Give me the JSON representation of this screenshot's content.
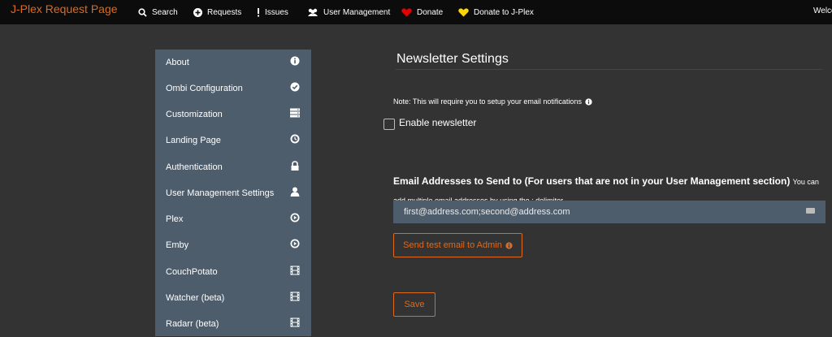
{
  "navbar": {
    "brand": "J-Plex Request Page",
    "items": [
      {
        "label": "Search",
        "icon": "search-icon"
      },
      {
        "label": "Requests",
        "icon": "plus-circle-icon"
      },
      {
        "label": "Issues",
        "icon": "exclamation-icon"
      },
      {
        "label": "User Management",
        "icon": "users-icon"
      },
      {
        "label": "Donate",
        "icon": "heart-icon"
      },
      {
        "label": "Donate to J-Plex",
        "icon": "heart-icon"
      }
    ],
    "welcome": "Welco"
  },
  "sidebar": {
    "items": [
      {
        "label": "About",
        "icon": "info-circle-icon"
      },
      {
        "label": "Ombi Configuration",
        "icon": "check-circle-icon"
      },
      {
        "label": "Customization",
        "icon": "server-icon"
      },
      {
        "label": "Landing Page",
        "icon": "clock-icon"
      },
      {
        "label": "Authentication",
        "icon": "lock-icon"
      },
      {
        "label": "User Management Settings",
        "icon": "user-icon"
      },
      {
        "label": "Plex",
        "icon": "play-circle-icon"
      },
      {
        "label": "Emby",
        "icon": "play-circle-icon"
      },
      {
        "label": "CouchPotato",
        "icon": "film-icon"
      },
      {
        "label": "Watcher (beta)",
        "icon": "film-icon"
      },
      {
        "label": "Radarr (beta)",
        "icon": "film-icon"
      }
    ]
  },
  "main": {
    "title": "Newsletter Settings",
    "note": "Note: This will require you to setup your email notifications",
    "enable_label": "Enable newsletter",
    "enable_checked": false,
    "emails_label": "Email Addresses to Send to (For users that are not in your User Management section)",
    "emails_help": "You can add multiple email addresses by using the ; delimiter",
    "emails_value": "first@address.com;second@address.com",
    "test_button": "Send test email to Admin",
    "save_button": "Save"
  },
  "colors": {
    "accent": "#df691a",
    "navbar_bg": "#0c0c0c",
    "page_bg": "#333333",
    "panel_bg": "#4e5d6c",
    "heart_donate": "#e60000",
    "heart_jplex": "#ffd700"
  }
}
